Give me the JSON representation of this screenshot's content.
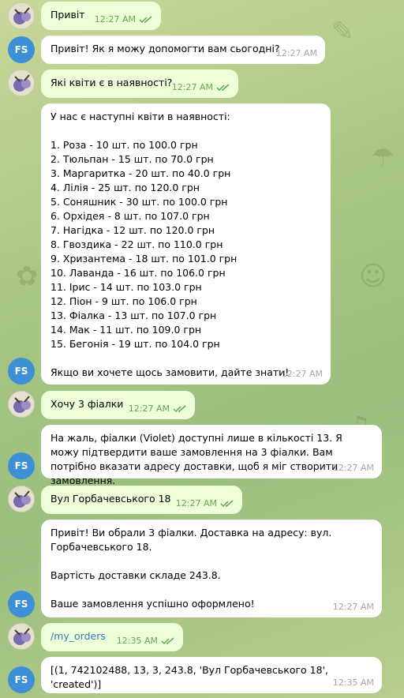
{
  "messages": [
    {
      "sender": "user",
      "text": "Привіт",
      "time": "12:27 AM"
    },
    {
      "sender": "bot",
      "avatar": "FS",
      "text": "Привіт! Як я можу допомогти вам сьогодні?",
      "time": "12:27 AM"
    },
    {
      "sender": "user",
      "text": "Які квіти є в наявності?",
      "time": "12:27 AM"
    },
    {
      "sender": "bot",
      "avatar": "FS",
      "time": "12:27 AM",
      "text": "У нас є наступні квіти в наявності:\n\n1. Роза - 10 шт. по 100.0 грн\n2. Тюльпан - 15 шт. по 70.0 грн\n3. Маргаритка - 20 шт. по 40.0 грн\n4. Лілія - 25 шт. по 120.0 грн\n5. Соняшник - 30 шт. по 100.0 грн\n6. Орхідея - 8 шт. по 107.0 грн\n7. Нагідка - 12 шт. по 120.0 грн\n8. Гвоздика - 22 шт. по 110.0 грн\n9. Хризантема - 18 шт. по 101.0 грн\n10. Лаванда - 16 шт. по 106.0 грн\n11. Ірис - 14 шт. по 103.0 грн\n12. Піон - 9 шт. по 106.0 грн\n13. Фіалка - 13 шт. по 107.0 грн\n14. Мак - 11 шт. по 109.0 грн\n15. Бегонія - 19 шт. по 104.0 грн\n\nЯкщо ви хочете щось замовити, дайте знати!"
    },
    {
      "sender": "user",
      "text": "Хочу 3 фіалки",
      "time": "12:27 AM"
    },
    {
      "sender": "bot",
      "avatar": "FS",
      "time": "12:27 AM",
      "text": "На жаль, фіалки (Violet) доступні лише в кількості 13. Я можу підтвердити ваше замовлення на 3 фіалки. Вам потрібно вказати адресу доставки, щоб я міг створити замовлення."
    },
    {
      "sender": "user",
      "text": "Вул Горбачевського 18",
      "time": "12:27 AM"
    },
    {
      "sender": "bot",
      "avatar": "FS",
      "time": "12:27 AM",
      "text": "Привіт! Ви обрали 3 фіалки. Доставка на адресу: вул. Горбачевського 18.\n\nВартість доставки складе 243.8.\n\nВаше замовлення успішно оформлено!"
    },
    {
      "sender": "user",
      "text": "/my_orders",
      "time": "12:35 AM"
    },
    {
      "sender": "bot",
      "avatar": "FS",
      "time": "12:35 AM",
      "text": "[(1, 742102488, 13, 3, 243.8, 'Вул Горбачевського 18', 'created')]"
    }
  ],
  "colors": {
    "outgoing_bubble": "#eefed9",
    "incoming_bubble": "#ffffff",
    "read_checks": "#5ea94d",
    "bot_avatar": "#3d8fd6",
    "command_link": "#2f7cbf"
  }
}
